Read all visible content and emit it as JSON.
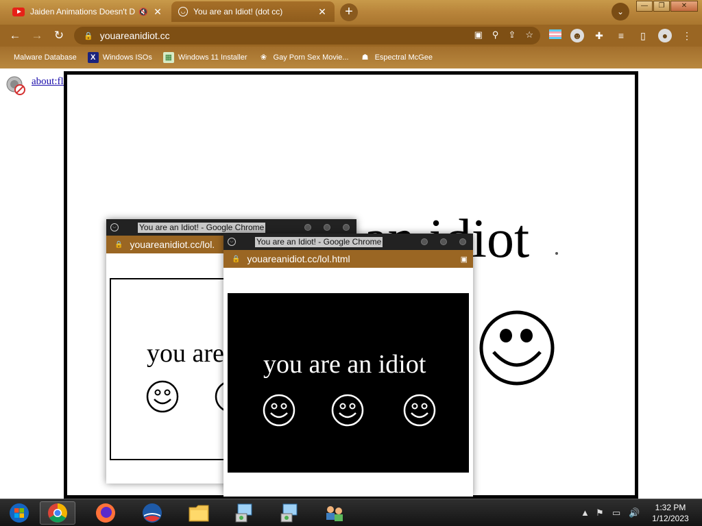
{
  "browser": {
    "tabs": [
      {
        "title": "Jaiden Animations Doesn't D",
        "close": "✕",
        "muted_icon": "🔇"
      },
      {
        "title": "You are an Idiot! (dot cc)",
        "close": "✕"
      }
    ],
    "new_tab": "+",
    "tab_search": "⌄",
    "window_controls": {
      "minimize": "—",
      "restore": "❐",
      "close": "✕"
    },
    "nav": {
      "back": "←",
      "forward": "→",
      "reload": "↻"
    },
    "url": "youareanidiot.cc",
    "bookmarks": [
      {
        "label": "Malware Database",
        "icon": "none"
      },
      {
        "label": "Windows ISOs",
        "icon": "x-icon"
      },
      {
        "label": "Windows 11 Installer",
        "icon": "image-icon"
      },
      {
        "label": "Gay Porn Sex Movie...",
        "icon": "paw-icon"
      },
      {
        "label": "Espectral McGee",
        "icon": "avatar-icon"
      }
    ]
  },
  "page": {
    "flash_link": "about:flash",
    "big_text": "an idiot"
  },
  "popups": [
    {
      "title": "You are an Idiot! - Google Chrome",
      "url": "youareanidiot.cc/lol.",
      "text": "you are"
    },
    {
      "title": "You are an Idiot! - Google Chrome",
      "url": "youareanidiot.cc/lol.html",
      "text": "you are an idiot"
    }
  ],
  "taskbar": {
    "time": "1:32 PM",
    "date": "1/12/2023"
  },
  "colors": {
    "theme_gold": "#b8843a",
    "theme_brown": "#9a6623",
    "link": "#1a0dab"
  }
}
